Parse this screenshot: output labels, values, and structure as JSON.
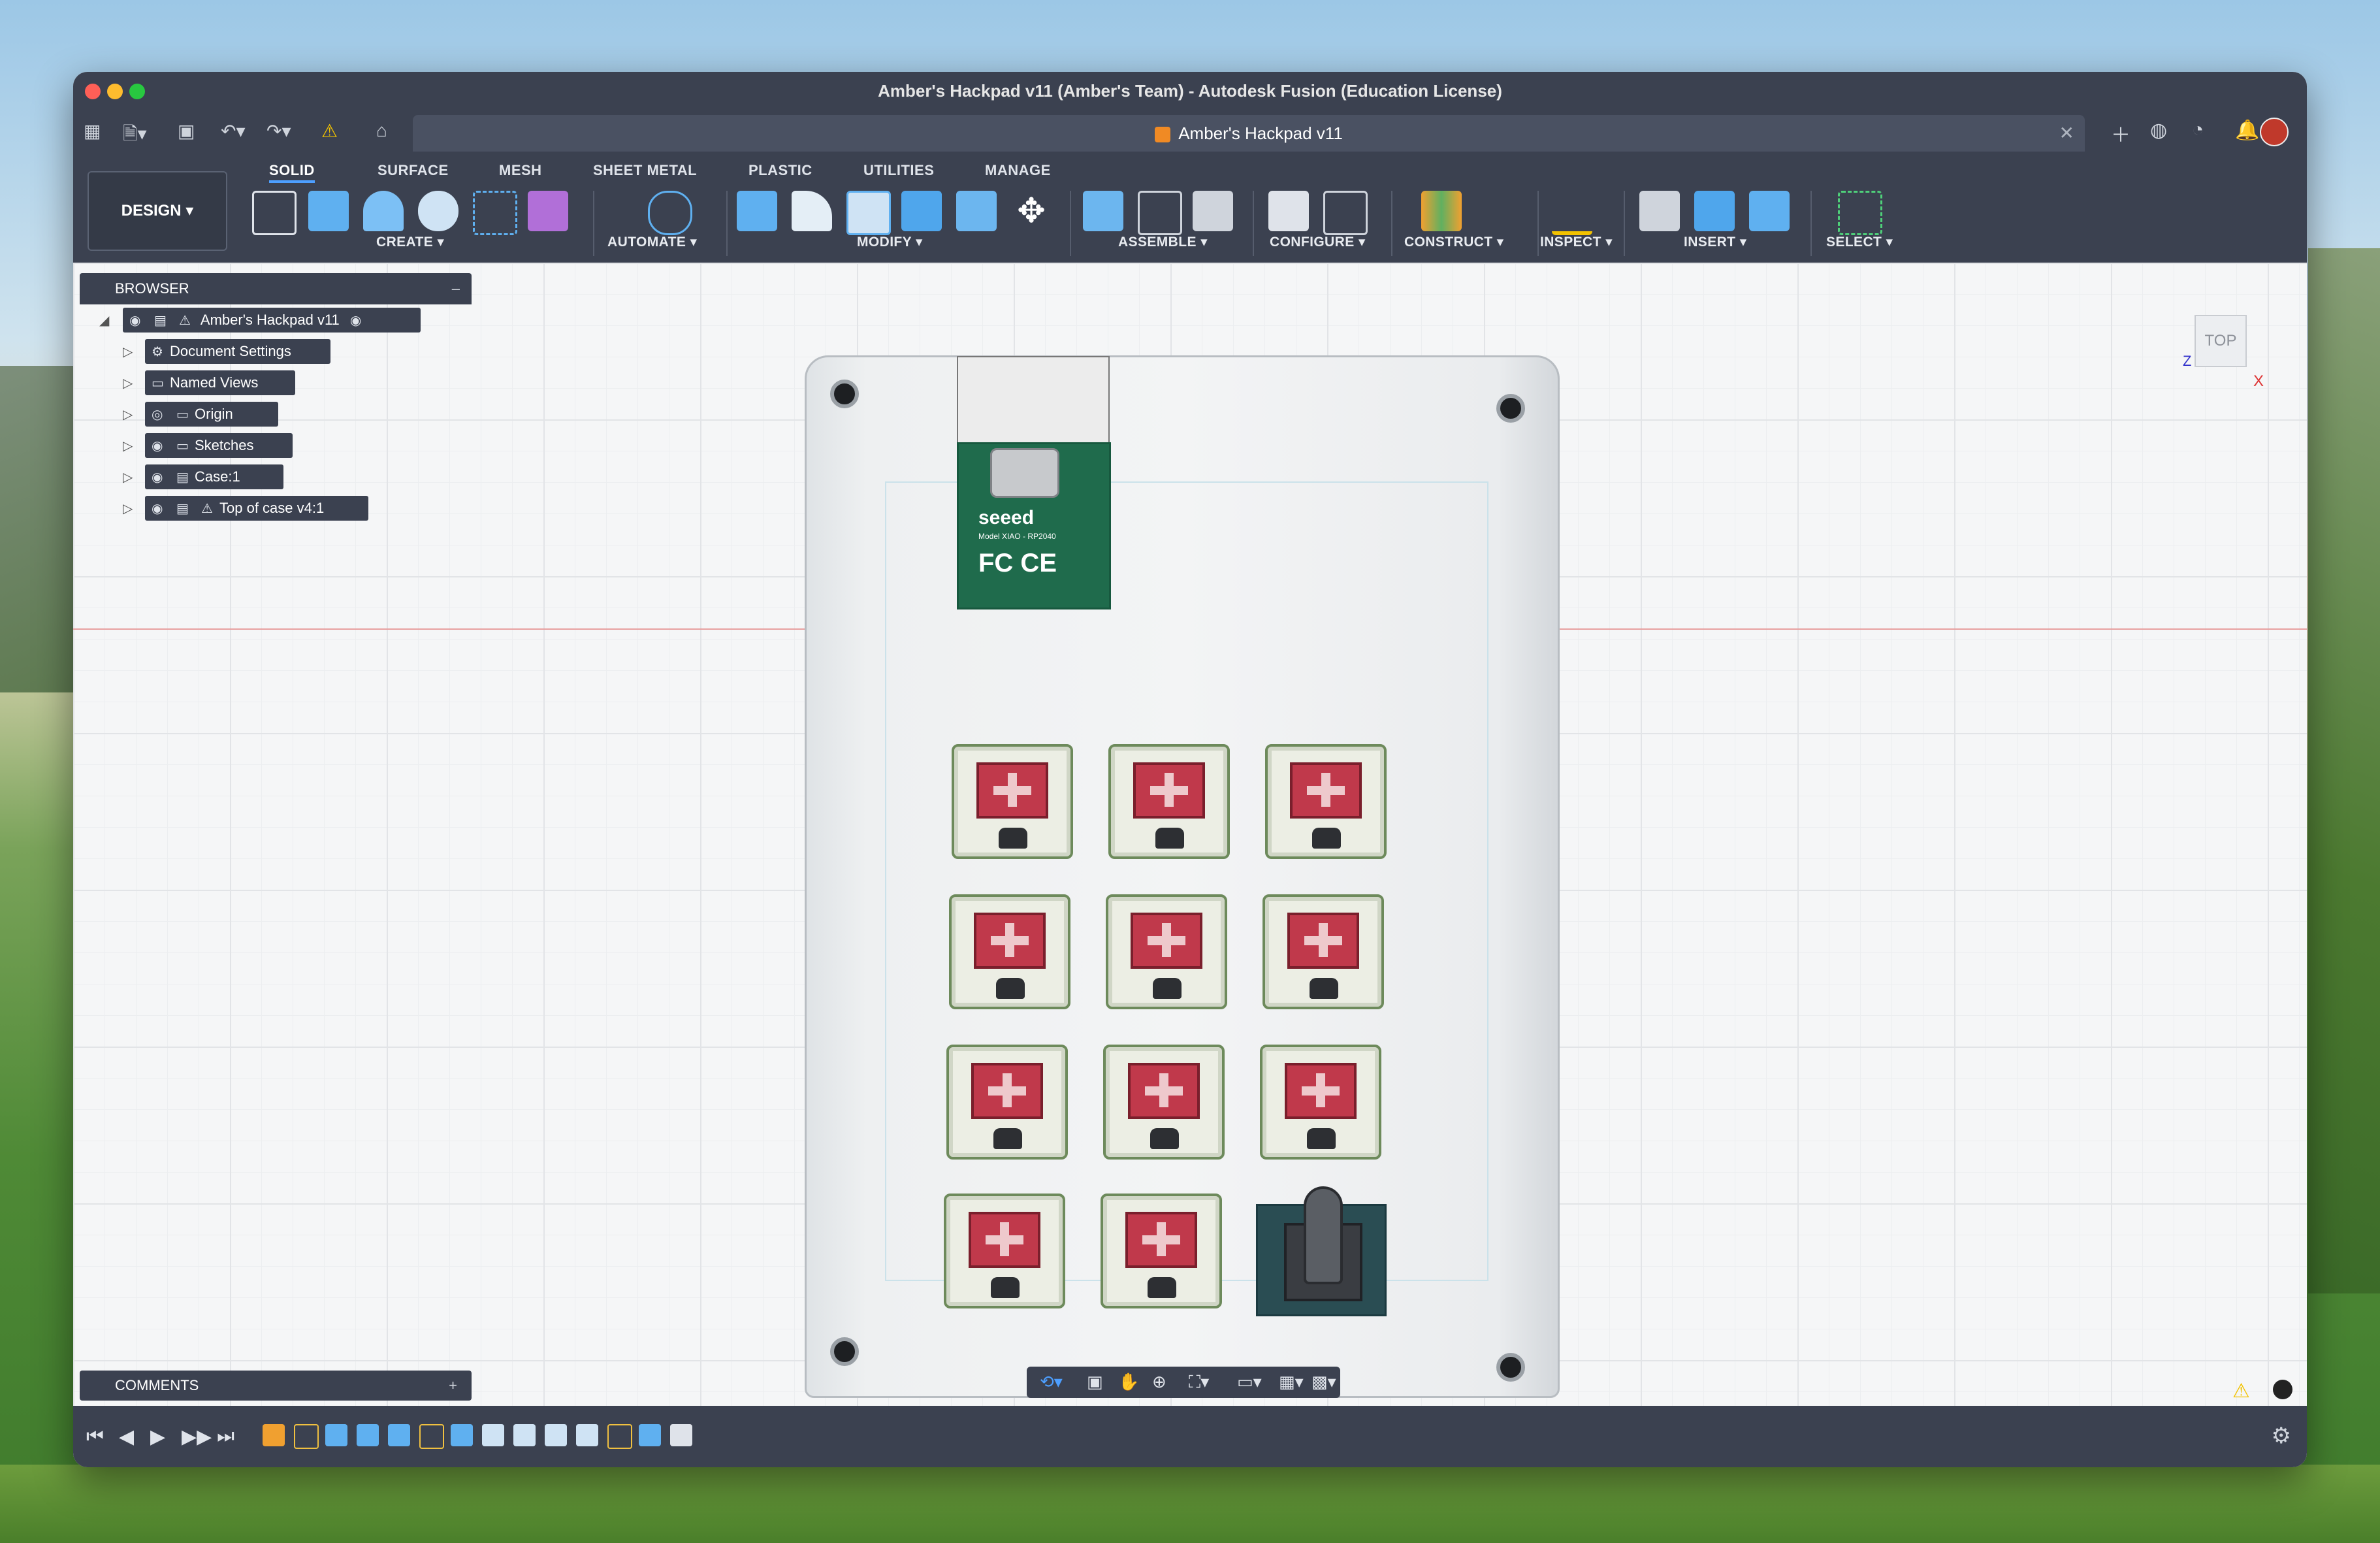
{
  "window": {
    "title": "Amber's Hackpad v11 (Amber's Team) - Autodesk Fusion (Education License)"
  },
  "tabbar": {
    "document_tab": "Amber's Hackpad v11"
  },
  "toolbar": {
    "design_menu": "DESIGN",
    "workspace_tabs": [
      "SOLID",
      "SURFACE",
      "MESH",
      "SHEET METAL",
      "PLASTIC",
      "UTILITIES",
      "MANAGE"
    ],
    "active_tab": "SOLID",
    "groups": [
      "CREATE",
      "AUTOMATE",
      "MODIFY",
      "ASSEMBLE",
      "CONFIGURE",
      "CONSTRUCT",
      "INSPECT",
      "INSERT",
      "SELECT"
    ]
  },
  "browser": {
    "title": "BROWSER",
    "root": "Amber's Hackpad v11",
    "items": [
      {
        "label": "Document Settings",
        "icon": "gear-icon"
      },
      {
        "label": "Named Views",
        "icon": "folder-icon"
      },
      {
        "label": "Origin",
        "icon": "folder-icon"
      },
      {
        "label": "Sketches",
        "icon": "folder-icon"
      },
      {
        "label": "Case:1",
        "icon": "component-icon"
      },
      {
        "label": "Top of case v4:1",
        "icon": "component-icon"
      }
    ]
  },
  "comments": {
    "title": "COMMENTS"
  },
  "model": {
    "mcu_brand": "seeed",
    "mcu_model": "Model XIAO - RP2040",
    "mcu_cert": "FC CE",
    "switch_count": 11,
    "encoder_count": 1
  },
  "viewcube": {
    "face": "TOP",
    "x_axis": "X",
    "z_axis": "Z"
  },
  "colors": {
    "chrome": "#3b4150",
    "accent": "#4d9fff",
    "switch_stem": "#c0394b",
    "pcb": "#1f6b4c"
  }
}
